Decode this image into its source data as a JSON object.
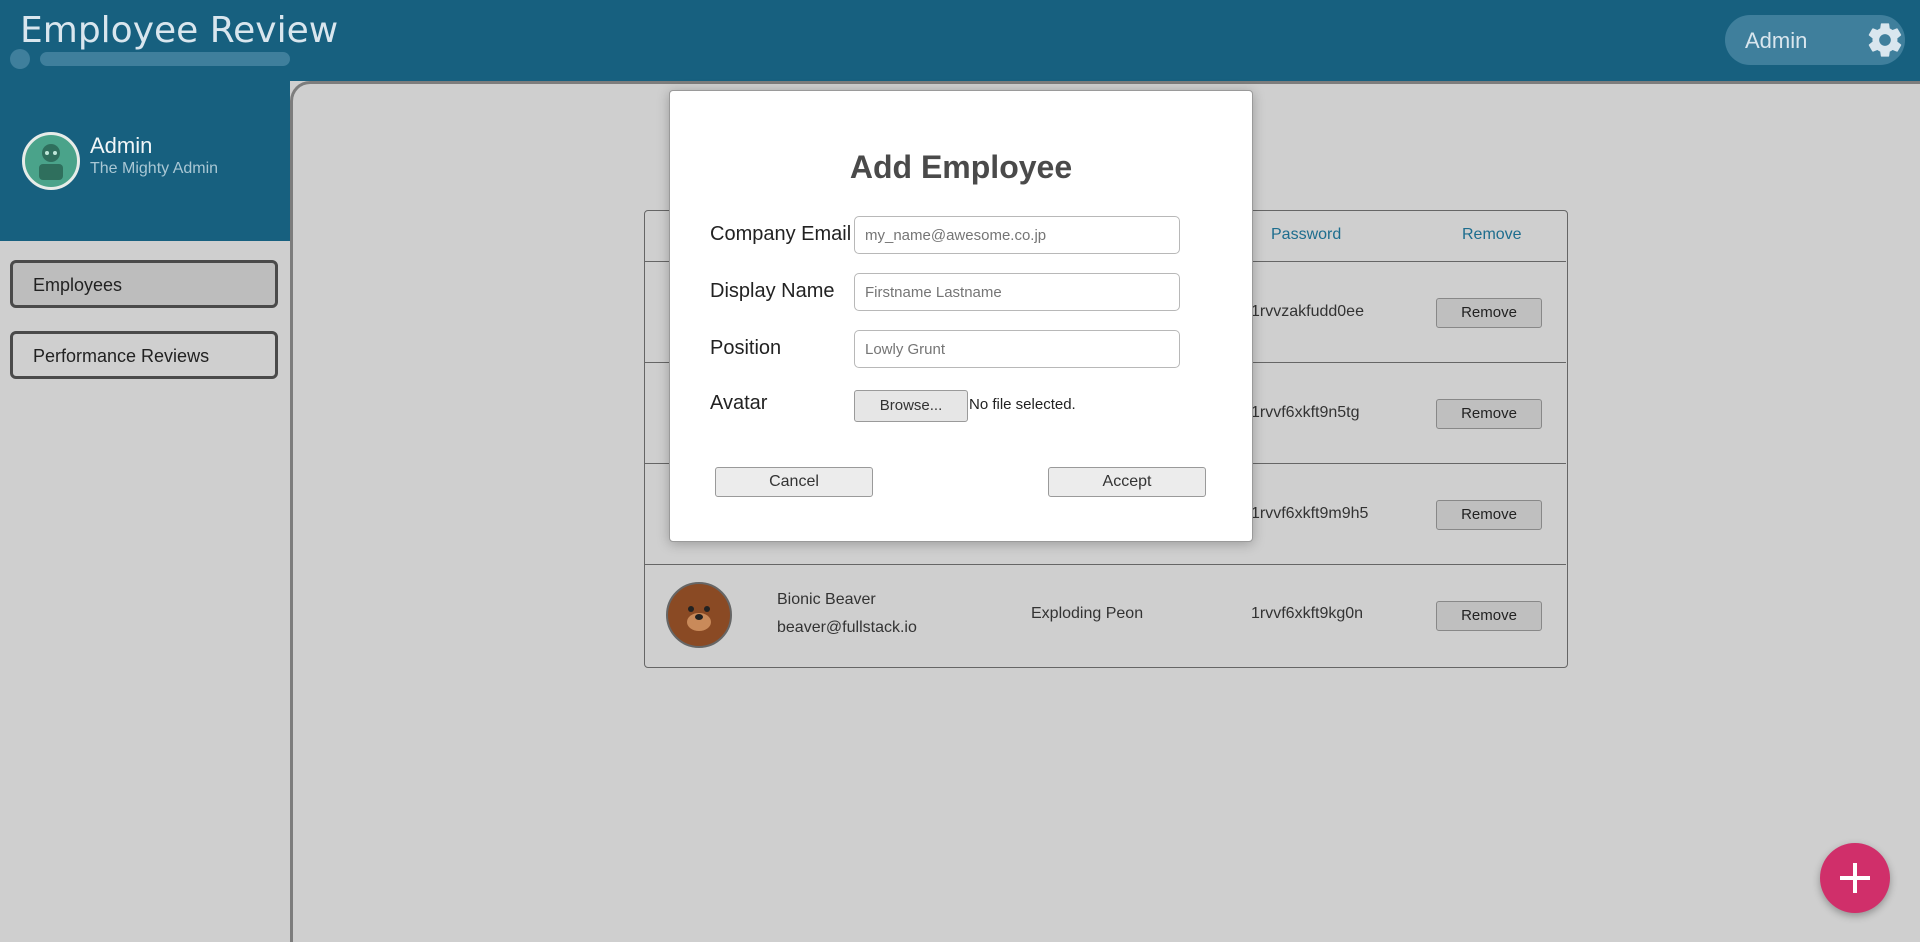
{
  "header": {
    "title": "Employee Review",
    "admin_label": "Admin",
    "accent_color": "#17607f"
  },
  "sidebar": {
    "user_name": "Admin",
    "user_subtitle": "The Mighty Admin",
    "nav": [
      {
        "label": "Employees"
      },
      {
        "label": "Performance Reviews"
      }
    ]
  },
  "table": {
    "headers": {
      "password": "Password",
      "remove": "Remove"
    },
    "rows": [
      {
        "password": "1rvvzakfudd0ee",
        "remove_label": "Remove"
      },
      {
        "password": "1rvvf6xkft9n5tg",
        "remove_label": "Remove"
      },
      {
        "password": "1rvvf6xkft9m9h5",
        "remove_label": "Remove"
      },
      {
        "name": "Bionic Beaver",
        "email": "beaver@fullstack.io",
        "position": "Exploding Peon",
        "password": "1rvvf6xkft9kg0n",
        "remove_label": "Remove"
      }
    ]
  },
  "modal": {
    "title": "Add Employee",
    "email_label": "Company Email",
    "email_placeholder": "my_name@awesome.co.jp",
    "name_label": "Display Name",
    "name_placeholder": "Firstname Lastname",
    "position_label": "Position",
    "position_placeholder": "Lowly Grunt",
    "avatar_label": "Avatar",
    "browse_label": "Browse...",
    "file_status": "No file selected.",
    "cancel_label": "Cancel",
    "accept_label": "Accept"
  },
  "fab": {
    "icon": "plus-icon",
    "color": "#d02f6a"
  }
}
